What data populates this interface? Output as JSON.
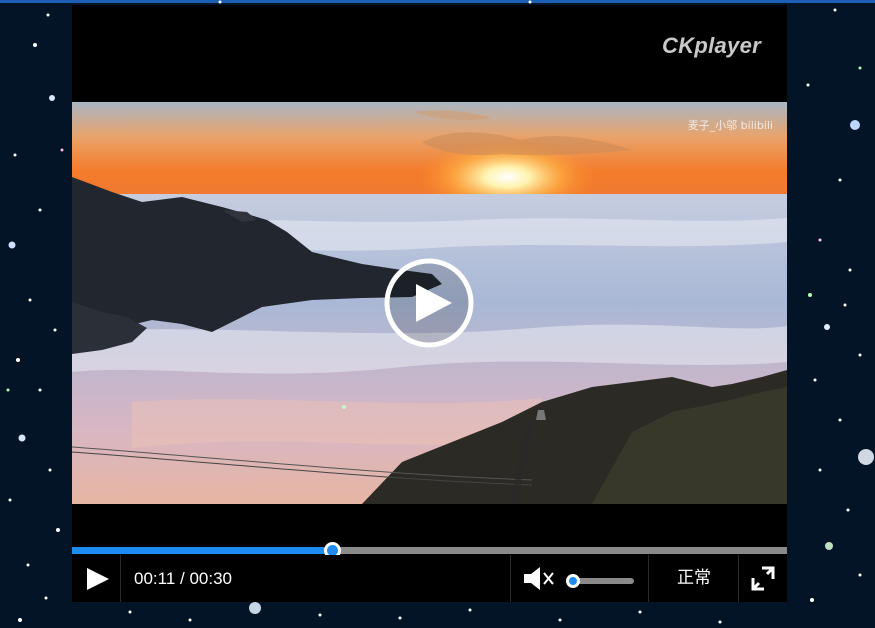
{
  "player": {
    "brand": "CKplayer",
    "watermark": "麦子_小邬 bilibili",
    "current_time": "00:11",
    "duration": "00:30",
    "time_display": "00:11 / 00:30",
    "progress": 0.363,
    "volume": 0.0,
    "muted": true,
    "speed_label": "正常"
  },
  "icons": {
    "center_play": "play-circle-icon",
    "play": "play-icon",
    "mute": "volume-muted-icon",
    "fullscreen": "fullscreen-icon"
  },
  "colors": {
    "accent": "#1e8cf5",
    "background": "#021426",
    "player_bg": "#000000",
    "track": "#8a8a8a"
  }
}
